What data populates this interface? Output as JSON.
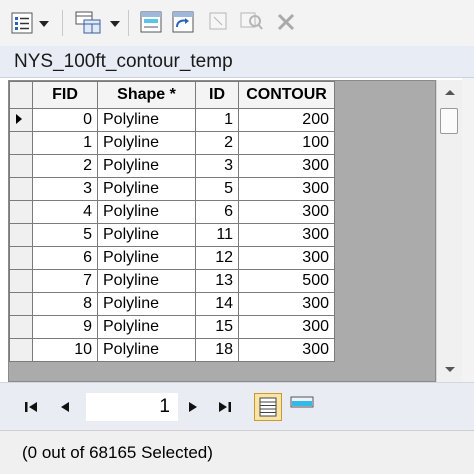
{
  "toolbar": {
    "icons": [
      "table-options-icon",
      "related-tables-icon",
      "select-by-attributes-icon",
      "switch-selection-icon",
      "clear-selection-icon",
      "zoom-to-selected-icon",
      "delete-selected-icon"
    ]
  },
  "table": {
    "title": "NYS_100ft_contour_temp",
    "columns": [
      "FID",
      "Shape *",
      "ID",
      "CONTOUR"
    ],
    "rows": [
      [
        "0",
        "Polyline",
        "1",
        "200"
      ],
      [
        "1",
        "Polyline",
        "2",
        "100"
      ],
      [
        "2",
        "Polyline",
        "3",
        "300"
      ],
      [
        "3",
        "Polyline",
        "5",
        "300"
      ],
      [
        "4",
        "Polyline",
        "6",
        "300"
      ],
      [
        "5",
        "Polyline",
        "11",
        "300"
      ],
      [
        "6",
        "Polyline",
        "12",
        "300"
      ],
      [
        "7",
        "Polyline",
        "13",
        "500"
      ],
      [
        "8",
        "Polyline",
        "14",
        "300"
      ],
      [
        "9",
        "Polyline",
        "15",
        "300"
      ],
      [
        "10",
        "Polyline",
        "18",
        "300"
      ]
    ]
  },
  "navigation": {
    "current_record": "1"
  },
  "status": {
    "selection_text": "(0 out of 68165 Selected)"
  },
  "colors": {
    "title_bar": "#e8edf5",
    "grid_line": "#7b7b7b",
    "active_view": "#f8e4a6"
  }
}
